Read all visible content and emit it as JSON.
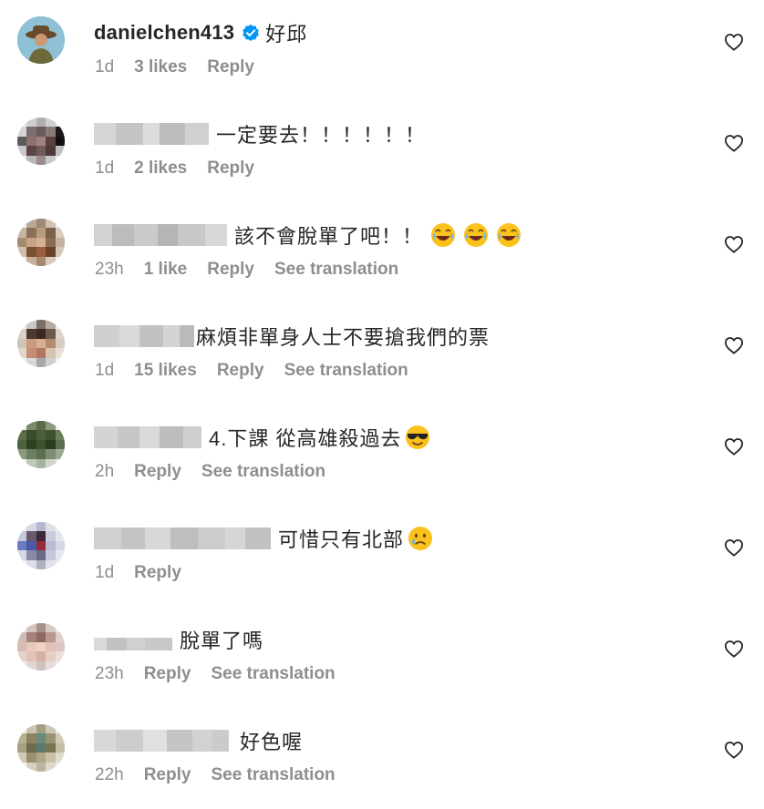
{
  "comments": [
    {
      "username": "danielchen413",
      "verified": true,
      "text": "好邱",
      "emoji": "",
      "time": "1d",
      "likes": "3 likes",
      "reply": "Reply",
      "translate": ""
    },
    {
      "username": "",
      "verified": false,
      "text": "一定要去！！！！！！",
      "emoji": "",
      "time": "1d",
      "likes": "2 likes",
      "reply": "Reply",
      "translate": ""
    },
    {
      "username": "",
      "verified": false,
      "text": "該不會脫單了吧！！",
      "emoji": "laugh-emoji",
      "time": "23h",
      "likes": "1 like",
      "reply": "Reply",
      "translate": "See translation"
    },
    {
      "username": "",
      "verified": false,
      "text": "麻煩非單身人士不要搶我們的票",
      "emoji": "",
      "time": "1d",
      "likes": "15 likes",
      "reply": "Reply",
      "translate": "See translation"
    },
    {
      "username": "",
      "verified": false,
      "text": "4.下課 從高雄殺過去",
      "emoji": "sunglasses-emoji",
      "time": "2h",
      "likes": "",
      "reply": "Reply",
      "translate": "See translation"
    },
    {
      "username": "",
      "verified": false,
      "text": "可惜只有北部",
      "emoji": "tear-smile-emoji",
      "time": "1d",
      "likes": "",
      "reply": "Reply",
      "translate": ""
    },
    {
      "username": "",
      "verified": false,
      "text": "脫單了嗎",
      "emoji": "",
      "time": "23h",
      "likes": "",
      "reply": "Reply",
      "translate": "See translation"
    },
    {
      "username": "",
      "verified": false,
      "text": "好色喔",
      "emoji": "",
      "time": "22h",
      "likes": "",
      "reply": "Reply",
      "translate": "See translation"
    }
  ],
  "icons": {
    "like": "heart-outline-icon",
    "verified": "verified-badge-icon"
  },
  "colors": {
    "text": "#262626",
    "meta": "#8e8e8e",
    "verified": "#0095f6"
  }
}
